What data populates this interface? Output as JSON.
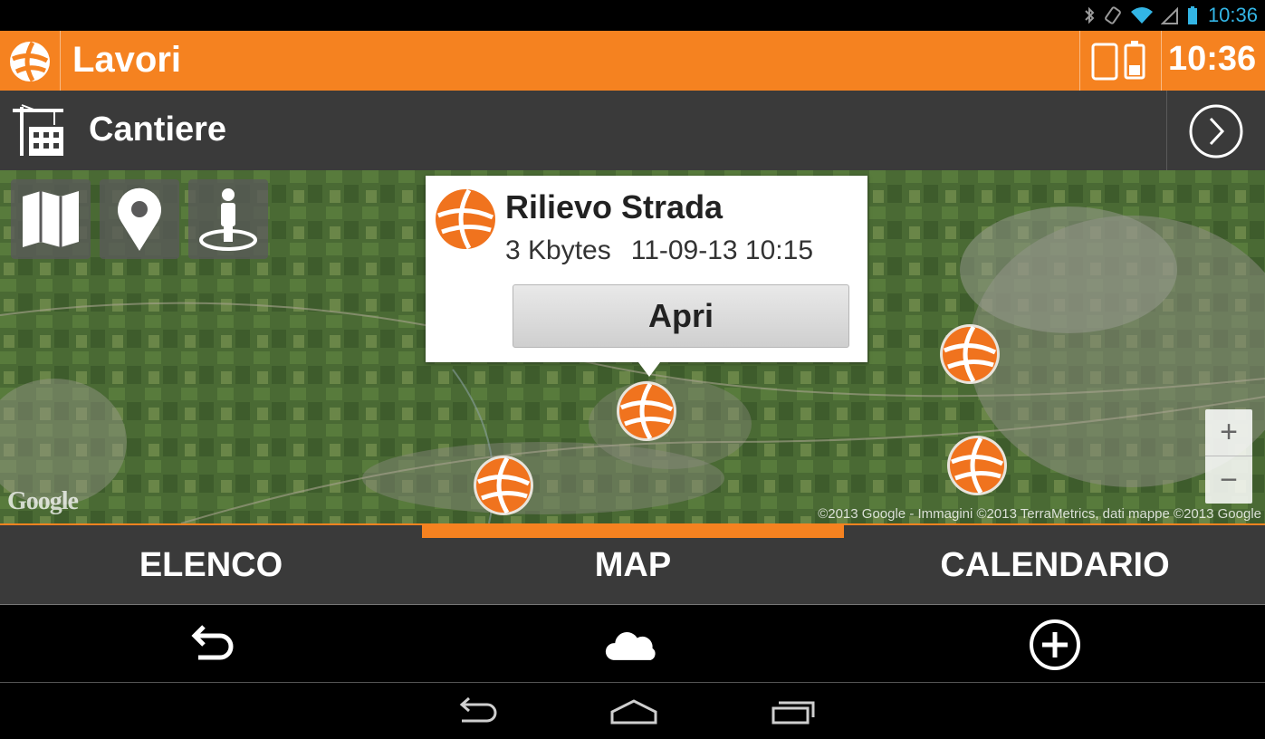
{
  "status_bar": {
    "time": "10:36",
    "icons": [
      "bluetooth-icon",
      "vibrate-icon",
      "wifi-icon",
      "signal-icon",
      "battery-icon"
    ]
  },
  "action_bar": {
    "title": "Lavori",
    "time": "10:36",
    "logo_icon": "app-logo-icon",
    "device_icon": "device-battery-icon"
  },
  "sub_bar": {
    "title": "Cantiere",
    "icon": "crane-building-icon",
    "next_icon": "chevron-right-circle-icon"
  },
  "map": {
    "buttons": [
      "map-layers-icon",
      "location-pin-icon",
      "person-locate-icon"
    ],
    "attribution": "©2013 Google - Immagini ©2013 TerraMetrics, dati mappe ©2013 Google",
    "google_logo": "Google",
    "zoom_in": "+",
    "zoom_out": "−",
    "marker_count": 5
  },
  "info_window": {
    "title": "Rilievo Strada",
    "size": "3 Kbytes",
    "datetime": "11-09-13 10:15",
    "button": "Apri"
  },
  "tabs": {
    "items": [
      {
        "label": "ELENCO"
      },
      {
        "label": "MAP"
      },
      {
        "label": "CALENDARIO"
      }
    ],
    "selected": "MAP"
  },
  "bottom_actions": [
    "undo-icon",
    "cloud-icon",
    "add-circle-icon"
  ],
  "nav_bar": [
    "back-icon",
    "home-icon",
    "recent-apps-icon"
  ],
  "colors": {
    "accent": "#f58220",
    "bar_dark": "#3a3a3a",
    "status_blue": "#33b5e5"
  }
}
